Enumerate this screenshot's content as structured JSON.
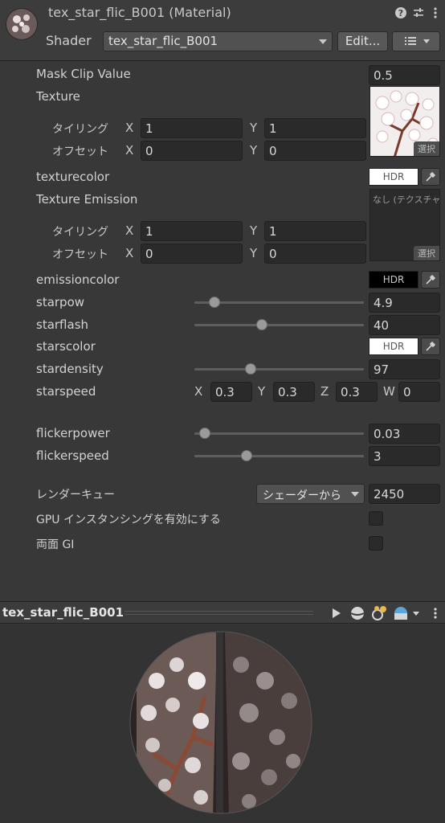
{
  "header": {
    "title": "tex_star_flic_B001 (Material)",
    "shader_label": "Shader",
    "shader_value": "tex_star_flic_B001",
    "edit_label": "Edit..."
  },
  "props": {
    "mask_clip": {
      "label": "Mask Clip Value",
      "value": "0.5"
    },
    "texture": {
      "label": "Texture",
      "tiling_label": "タイリング",
      "offset_label": "オフセット",
      "tiling_x": "1",
      "tiling_y": "1",
      "offset_x": "0",
      "offset_y": "0",
      "select_label": "選択"
    },
    "texturecolor": {
      "label": "texturecolor",
      "hdr": "HDR",
      "color": "#ffffff"
    },
    "texture_emission": {
      "label": "Texture Emission",
      "tiling_label": "タイリング",
      "offset_label": "オフセット",
      "tiling_x": "1",
      "tiling_y": "1",
      "offset_x": "0",
      "offset_y": "0",
      "none_label": "なし (テクスチャ)",
      "select_label": "選択"
    },
    "emissioncolor": {
      "label": "emissioncolor",
      "hdr": "HDR",
      "color": "#000000"
    },
    "starpow": {
      "label": "starpow",
      "value": "4.9"
    },
    "starflash": {
      "label": "starflash",
      "value": "40"
    },
    "starscolor": {
      "label": "starscolor",
      "hdr": "HDR",
      "color": "#ffffff"
    },
    "stardensity": {
      "label": "stardensity",
      "value": "97"
    },
    "starspeed": {
      "label": "starspeed",
      "x": "0.3",
      "y": "0.3",
      "z": "0.3",
      "w": "0"
    },
    "flickerpower": {
      "label": "flickerpower",
      "value": "0.03"
    },
    "flickerspeed": {
      "label": "flickerspeed",
      "value": "3"
    },
    "render_queue": {
      "label": "レンダーキュー",
      "mode": "シェーダーから",
      "value": "2450"
    },
    "gpu_instancing": {
      "label": "GPU インスタンシングを有効にする",
      "checked": false
    },
    "double_sided_gi": {
      "label": "両面 GI",
      "checked": false
    }
  },
  "axes": {
    "x": "X",
    "y": "Y",
    "z": "Z",
    "w": "W"
  },
  "slider_levels": {
    "starpow": 0.12,
    "starflash": 0.4,
    "stardensity": 0.33,
    "flickerpower": 0.06,
    "flickerspeed": 0.31
  },
  "preview": {
    "title": "tex_star_flic_B001"
  },
  "icons": [
    "help-icon",
    "preset-icon",
    "more-icon",
    "list-icon",
    "play-icon",
    "sphere-icon",
    "light-icon",
    "skybox-icon",
    "eyedropper-icon"
  ]
}
